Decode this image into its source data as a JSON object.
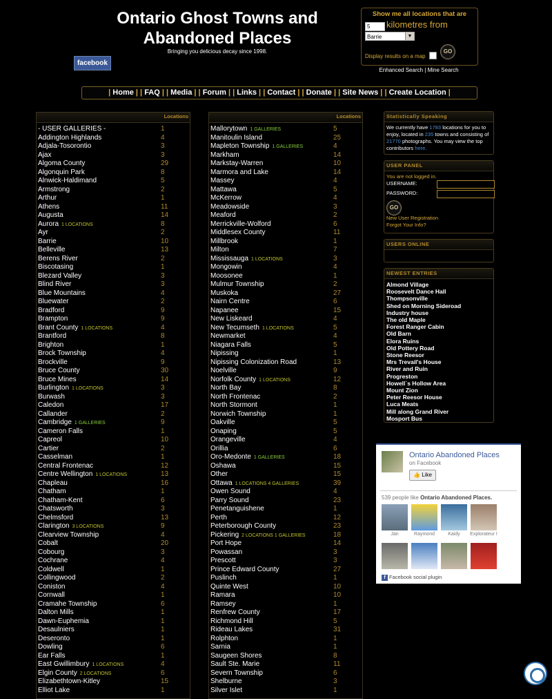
{
  "header": {
    "title_line1": "Ontario Ghost Towns and",
    "title_line2": "Abandoned Places",
    "tagline": "Bringing you delicious decay since 1998.",
    "facebook_button": "facebook"
  },
  "search": {
    "heading": "Show me all locations that are",
    "km_value": "5",
    "km_label": "kilometres from",
    "city_selected": "Barrie",
    "map_label": "Display results on a map",
    "go_label": "GO",
    "enhanced": "Enhanced Search",
    "mine": "Mine Search"
  },
  "nav": {
    "items": [
      "Home",
      "FAQ",
      "Media",
      "Forum",
      "Links",
      "Contact",
      "Donate",
      "Site News",
      "Create Location"
    ]
  },
  "columns": {
    "header_label": "Locations",
    "left": [
      {
        "name": "- USER GALLERIES -",
        "count": "1"
      },
      {
        "name": "Addington Highlands",
        "count": "4"
      },
      {
        "name": "Adjala-Tosorontio",
        "count": "3"
      },
      {
        "name": "Ajax",
        "count": "3"
      },
      {
        "name": "Algoma County",
        "count": "29"
      },
      {
        "name": "Algonquin Park",
        "count": "8"
      },
      {
        "name": "Alnwick-Haldimand",
        "count": "5"
      },
      {
        "name": "Armstrong",
        "count": "2"
      },
      {
        "name": "Arthur",
        "count": "1"
      },
      {
        "name": "Athens",
        "count": "11"
      },
      {
        "name": "Augusta",
        "count": "14"
      },
      {
        "name": "Aurora",
        "extra": "1 LOCATIONS",
        "count": "8"
      },
      {
        "name": "Ayr",
        "count": "2"
      },
      {
        "name": "Barrie",
        "count": "10"
      },
      {
        "name": "Belleville",
        "count": "13"
      },
      {
        "name": "Berens River",
        "count": "2"
      },
      {
        "name": "Biscotasing",
        "count": "1"
      },
      {
        "name": "Blezard Valley",
        "count": "3"
      },
      {
        "name": "Blind River",
        "count": "3"
      },
      {
        "name": "Blue Mountains",
        "count": "4"
      },
      {
        "name": "Bluewater",
        "count": "2"
      },
      {
        "name": "Bradford",
        "count": "9"
      },
      {
        "name": "Brampton",
        "count": "9"
      },
      {
        "name": "Brant County",
        "extra": "1 LOCATIONS",
        "count": "4"
      },
      {
        "name": "Brantford",
        "count": "8"
      },
      {
        "name": "Brighton",
        "count": "1"
      },
      {
        "name": "Brock Township",
        "count": "4"
      },
      {
        "name": "Brockville",
        "count": "9"
      },
      {
        "name": "Bruce County",
        "count": "30"
      },
      {
        "name": "Bruce Mines",
        "count": "14"
      },
      {
        "name": "Burlington",
        "extra": "1 LOCATIONS",
        "count": "3"
      },
      {
        "name": "Burwash",
        "count": "3"
      },
      {
        "name": "Caledon",
        "count": "17"
      },
      {
        "name": "Callander",
        "count": "2"
      },
      {
        "name": "Cambridge",
        "extra": "1 GALLERIES",
        "extra_green": true,
        "count": "9"
      },
      {
        "name": "Cameron Falls",
        "count": "1"
      },
      {
        "name": "Capreol",
        "count": "10"
      },
      {
        "name": "Cartier",
        "count": "2"
      },
      {
        "name": "Casselman",
        "count": "1"
      },
      {
        "name": "Central Frontenac",
        "count": "12"
      },
      {
        "name": "Centre Wellington",
        "extra": "1 LOCATIONS",
        "count": "13"
      },
      {
        "name": "Chapleau",
        "count": "16"
      },
      {
        "name": "Chatham",
        "count": "1"
      },
      {
        "name": "Chatham-Kent",
        "count": "6"
      },
      {
        "name": "Chatsworth",
        "count": "3"
      },
      {
        "name": "Chelmsford",
        "count": "13"
      },
      {
        "name": "Clarington",
        "extra": "3 LOCATIONS",
        "count": "9"
      },
      {
        "name": "Clearview Township",
        "count": "4"
      },
      {
        "name": "Cobalt",
        "count": "20"
      },
      {
        "name": "Cobourg",
        "count": "3"
      },
      {
        "name": "Cochrane",
        "count": "4"
      },
      {
        "name": "Coldwell",
        "count": "1"
      },
      {
        "name": "Collingwood",
        "count": "2"
      },
      {
        "name": "Coniston",
        "count": "4"
      },
      {
        "name": "Cornwall",
        "count": "1"
      },
      {
        "name": "Cramahe Township",
        "count": "6"
      },
      {
        "name": "Dalton Mills",
        "count": "1"
      },
      {
        "name": "Dawn-Euphemia",
        "count": "1"
      },
      {
        "name": "Desaulniers",
        "count": "1"
      },
      {
        "name": "Deseronto",
        "count": "1"
      },
      {
        "name": "Dowling",
        "count": "6"
      },
      {
        "name": "Ear Falls",
        "count": "1"
      },
      {
        "name": "East Gwillimbury",
        "extra": "1 LOCATIONS",
        "count": "4"
      },
      {
        "name": "Elgin County",
        "extra": "2 LOCATIONS",
        "count": "6"
      },
      {
        "name": "Elizabethtown-Kitley",
        "count": "15"
      },
      {
        "name": "Elliot Lake",
        "count": "1"
      }
    ],
    "right": [
      {
        "name": "Mallorytown",
        "extra": "1 GALLERIES",
        "extra_green": true,
        "count": "5"
      },
      {
        "name": "Manitoulin Island",
        "count": "25"
      },
      {
        "name": "Mapleton Township",
        "extra": "1 GALLERIES",
        "extra_green": true,
        "count": "4"
      },
      {
        "name": "Markham",
        "count": "14"
      },
      {
        "name": "Markstay-Warren",
        "count": "10"
      },
      {
        "name": "Marmora and Lake",
        "count": "14"
      },
      {
        "name": "Massey",
        "count": "4"
      },
      {
        "name": "Mattawa",
        "count": "5"
      },
      {
        "name": "McKerrow",
        "count": "4"
      },
      {
        "name": "Meadowside",
        "count": "3"
      },
      {
        "name": "Meaford",
        "count": "2"
      },
      {
        "name": "Merrickville-Wolford",
        "count": "6"
      },
      {
        "name": "Middlesex County",
        "count": "11"
      },
      {
        "name": "Millbrook",
        "count": "1"
      },
      {
        "name": "Milton",
        "count": "7"
      },
      {
        "name": "Mississauga",
        "extra": "1 LOCATIONS",
        "count": "3"
      },
      {
        "name": "Mongowin",
        "count": "4"
      },
      {
        "name": "Moosonee",
        "count": "1"
      },
      {
        "name": "Mulmur Township",
        "count": "2"
      },
      {
        "name": "Muskoka",
        "count": "27"
      },
      {
        "name": "Nairn Centre",
        "count": "6"
      },
      {
        "name": "Napanee",
        "count": "15"
      },
      {
        "name": "New Liskeard",
        "count": "4"
      },
      {
        "name": "New Tecumseth",
        "extra": "1 LOCATIONS",
        "count": "5"
      },
      {
        "name": "Newmarket",
        "count": "4"
      },
      {
        "name": "Niagara Falls",
        "count": "5"
      },
      {
        "name": "Nipissing",
        "count": "1"
      },
      {
        "name": "Nipissing Colonization Road",
        "count": "13"
      },
      {
        "name": "Noelville",
        "count": "9"
      },
      {
        "name": "Norfolk County",
        "extra": "1 LOCATIONS",
        "count": "12"
      },
      {
        "name": "North Bay",
        "count": "8"
      },
      {
        "name": "North Frontenac",
        "count": "2"
      },
      {
        "name": "North Stormont",
        "count": "1"
      },
      {
        "name": "Norwich Township",
        "count": "1"
      },
      {
        "name": "Oakville",
        "count": "5"
      },
      {
        "name": "Onaping",
        "count": "5"
      },
      {
        "name": "Orangeville",
        "count": "4"
      },
      {
        "name": "Orillia",
        "count": "6"
      },
      {
        "name": "Oro-Medonte",
        "extra": "1 GALLERIES",
        "extra_green": true,
        "count": "18"
      },
      {
        "name": "Oshawa",
        "count": "15"
      },
      {
        "name": "Other",
        "count": "15"
      },
      {
        "name": "Ottawa",
        "extra": "1 LOCATIONS 4 GALLERIES",
        "count": "39"
      },
      {
        "name": "Owen Sound",
        "count": "4"
      },
      {
        "name": "Parry Sound",
        "count": "23"
      },
      {
        "name": "Penetanguishene",
        "count": "1"
      },
      {
        "name": "Perth",
        "count": "12"
      },
      {
        "name": "Peterborough County",
        "count": "23"
      },
      {
        "name": "Pickering",
        "extra": "2 LOCATIONS 1 GALLERIES",
        "count": "18"
      },
      {
        "name": "Port Hope",
        "count": "14"
      },
      {
        "name": "Powassan",
        "count": "3"
      },
      {
        "name": "Prescott",
        "count": "3"
      },
      {
        "name": "Prince Edward County",
        "count": "27"
      },
      {
        "name": "Puslinch",
        "count": "1"
      },
      {
        "name": "Quinte West",
        "count": "10"
      },
      {
        "name": "Ramara",
        "count": "10"
      },
      {
        "name": "Ramsey",
        "count": "1"
      },
      {
        "name": "Renfrew County",
        "count": "17"
      },
      {
        "name": "Richmond Hill",
        "count": "5"
      },
      {
        "name": "Rideau Lakes",
        "count": "31"
      },
      {
        "name": "Rolphton",
        "count": "1"
      },
      {
        "name": "Sarnia",
        "count": "1"
      },
      {
        "name": "Saugeen Shores",
        "count": "8"
      },
      {
        "name": "Sault Ste. Marie",
        "count": "11"
      },
      {
        "name": "Severn Township",
        "count": "6"
      },
      {
        "name": "Shelburne",
        "count": "3"
      },
      {
        "name": "Silver Islet",
        "count": "1"
      }
    ]
  },
  "stats": {
    "title": "Statistically Speaking",
    "t1": "We currently have",
    "locations": "1783",
    "t2": "locations for you to enjoy, located in",
    "towns": "235",
    "t3": "towns and consisting of",
    "photos": "21770",
    "t4": "photographs.",
    "t5": "You may view the top contributors",
    "here": "here."
  },
  "user_panel": {
    "title": "USER PANEL",
    "status": "You are not logged in.",
    "username_label": "USERNAME:",
    "password_label": "PASSWORD:",
    "go_label": "GO",
    "register": "New User Registration",
    "forgot": "Forgot Your Info?"
  },
  "users_online": {
    "title": "USERS ONLINE"
  },
  "newest": {
    "title": "NEWEST ENTRIES",
    "items": [
      "Almond Village",
      "Roosevelt Dance Hall",
      "Thompsonville",
      "Shed on Morning Sideroad",
      "Industry house",
      "The old Maple",
      "Forest Ranger Cabin",
      "Old Barn",
      "Elora Ruins",
      "Old Pottery Road",
      "Stone Reesor",
      "Mrs Trevail's House",
      "River and Ruin",
      "Progreston",
      "Howell`s Hollow Area",
      "Mount Zion",
      "Peter Reesor House",
      "Luca Meats",
      "Mill along Grand River",
      "Mosport Bus"
    ]
  },
  "fb_widget": {
    "page_name": "Ontario Abandoned Places",
    "on_facebook": "on Facebook",
    "like": "Like",
    "count_text": "539 people like",
    "count_name": "Ontario Abandoned Places.",
    "faces": [
      "Jan",
      "Raymond",
      "Kaidy",
      "Explorateur I"
    ],
    "footer": "Facebook social plugin"
  }
}
